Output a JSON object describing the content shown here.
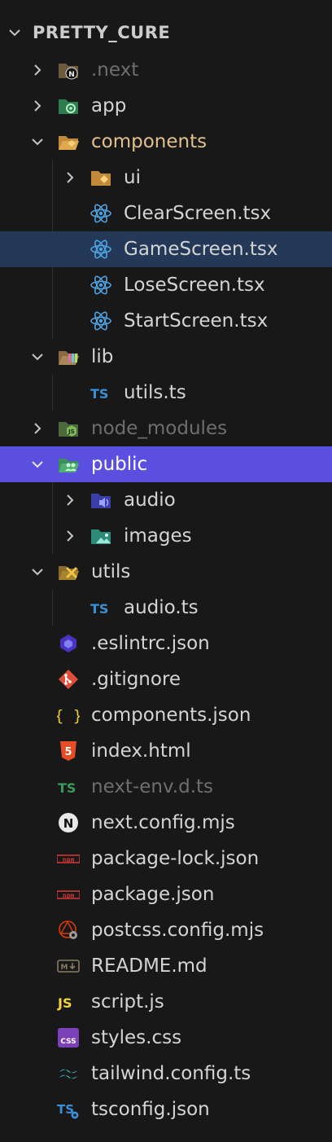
{
  "explorer": {
    "root_title": "PRETTY_CURE",
    "items": [
      {
        "label": ".next",
        "kind": "folder",
        "state": "collapsed",
        "dim": true
      },
      {
        "label": "app",
        "kind": "folder",
        "state": "collapsed"
      },
      {
        "label": "components",
        "kind": "folder",
        "state": "expanded",
        "modified": true
      },
      {
        "label": "ui",
        "kind": "folder",
        "state": "collapsed"
      },
      {
        "label": "ClearScreen.tsx",
        "kind": "file",
        "icon": "react-icon"
      },
      {
        "label": "GameScreen.tsx",
        "kind": "file",
        "icon": "react-icon",
        "selected": true
      },
      {
        "label": "LoseScreen.tsx",
        "kind": "file",
        "icon": "react-icon"
      },
      {
        "label": "StartScreen.tsx",
        "kind": "file",
        "icon": "react-icon"
      },
      {
        "label": "lib",
        "kind": "folder",
        "state": "expanded"
      },
      {
        "label": "utils.ts",
        "kind": "file",
        "icon": "typescript-icon"
      },
      {
        "label": "node_modules",
        "kind": "folder",
        "state": "collapsed",
        "dim": true
      },
      {
        "label": "public",
        "kind": "folder",
        "state": "expanded",
        "focused": true
      },
      {
        "label": "audio",
        "kind": "folder",
        "state": "collapsed"
      },
      {
        "label": "images",
        "kind": "folder",
        "state": "collapsed"
      },
      {
        "label": "utils",
        "kind": "folder",
        "state": "expanded"
      },
      {
        "label": "audio.ts",
        "kind": "file",
        "icon": "typescript-icon"
      },
      {
        "label": ".eslintrc.json",
        "kind": "file",
        "icon": "eslint-icon"
      },
      {
        "label": ".gitignore",
        "kind": "file",
        "icon": "git-icon"
      },
      {
        "label": "components.json",
        "kind": "file",
        "icon": "json-braces-icon"
      },
      {
        "label": "index.html",
        "kind": "file",
        "icon": "html5-icon"
      },
      {
        "label": "next-env.d.ts",
        "kind": "file",
        "icon": "typescript-icon",
        "dim": true
      },
      {
        "label": "next.config.mjs",
        "kind": "file",
        "icon": "nextjs-icon"
      },
      {
        "label": "package-lock.json",
        "kind": "file",
        "icon": "npm-icon"
      },
      {
        "label": "package.json",
        "kind": "file",
        "icon": "npm-icon"
      },
      {
        "label": "postcss.config.mjs",
        "kind": "file",
        "icon": "postcss-icon"
      },
      {
        "label": "README.md",
        "kind": "file",
        "icon": "markdown-icon"
      },
      {
        "label": "script.js",
        "kind": "file",
        "icon": "javascript-icon"
      },
      {
        "label": "styles.css",
        "kind": "file",
        "icon": "css-icon"
      },
      {
        "label": "tailwind.config.ts",
        "kind": "file",
        "icon": "tailwind-icon"
      },
      {
        "label": "tsconfig.json",
        "kind": "file",
        "icon": "tsconfig-icon"
      }
    ]
  },
  "colors": {
    "background": "#181818",
    "selected_row": "#243858",
    "focused_row": "#5b4fe0",
    "text": "#d4d4d4",
    "dim_text": "#6e6e6e",
    "modified_text": "#e2c08d"
  }
}
